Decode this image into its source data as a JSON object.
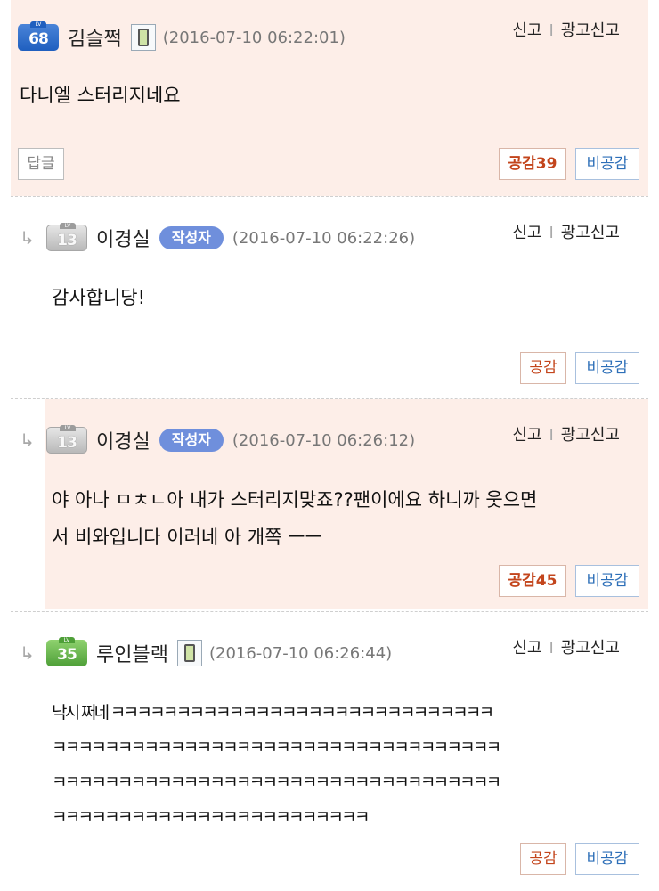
{
  "report_labels": {
    "report": "신고",
    "separator": "I",
    "ad_report": "광고신고"
  },
  "buttons": {
    "reply": "답글",
    "like": "공감",
    "dislike": "비공감"
  },
  "comments": [
    {
      "level": "68",
      "level_tag": "LV",
      "author": "김슬쩍",
      "author_badge": "",
      "has_mobile_icon": true,
      "date": "(2016-07-10 06:22:01)",
      "text": "다니엘 스터리지네요",
      "likes": "39",
      "is_reply": false,
      "highlighted": true
    },
    {
      "level": "13",
      "level_tag": "LV",
      "author": "이경실",
      "author_badge": "작성자",
      "has_mobile_icon": false,
      "date": "(2016-07-10 06:22:26)",
      "text": "감사합니당!",
      "likes": "",
      "is_reply": true,
      "highlighted": false
    },
    {
      "level": "13",
      "level_tag": "LV",
      "author": "이경실",
      "author_badge": "작성자",
      "has_mobile_icon": false,
      "date": "(2016-07-10 06:26:12)",
      "text": "야 아나 ㅁㅊㄴ아 내가 스터리지맞죠??팬이에요 하니까 웃으면\n서 비와입니다 이러네 아 개쪽 ㅡㅡ",
      "likes": "45",
      "is_reply": true,
      "highlighted": true
    },
    {
      "level": "35",
      "level_tag": "LV",
      "author": "루인블랙",
      "author_badge": "",
      "has_mobile_icon": true,
      "date": "(2016-07-10 06:26:44)",
      "text": "낙시 쩌네 ㅋㅋㅋㅋㅋㅋㅋㅋㅋㅋㅋㅋㅋㅋㅋㅋㅋㅋㅋㅋㅋㅋㅋㅋㅋㅋㅋㅋㅋ\nㅋㅋㅋㅋㅋㅋㅋㅋㅋㅋㅋㅋㅋㅋㅋㅋㅋㅋㅋㅋㅋㅋㅋㅋㅋㅋㅋㅋㅋㅋㅋㅋㅋㅋ\nㅋㅋㅋㅋㅋㅋㅋㅋㅋㅋㅋㅋㅋㅋㅋㅋㅋㅋㅋㅋㅋㅋㅋㅋㅋㅋㅋㅋㅋㅋㅋㅋㅋㅋ\nㅋㅋㅋㅋㅋㅋㅋㅋㅋㅋㅋㅋㅋㅋㅋㅋㅋㅋㅋㅋㅋㅋㅋㅋ",
      "likes": "",
      "is_reply": true,
      "highlighted": false
    }
  ],
  "colors": {
    "highlight_bg": "#fdeee8",
    "like_red": "#c3451c",
    "dislike_blue": "#2d6fb8",
    "author_badge_blue": "#6f8fdc"
  },
  "icons": {
    "reply_arrow": "reply-arrow-icon",
    "mobile": "mobile-phone-icon",
    "level": "level-badge-icon"
  }
}
